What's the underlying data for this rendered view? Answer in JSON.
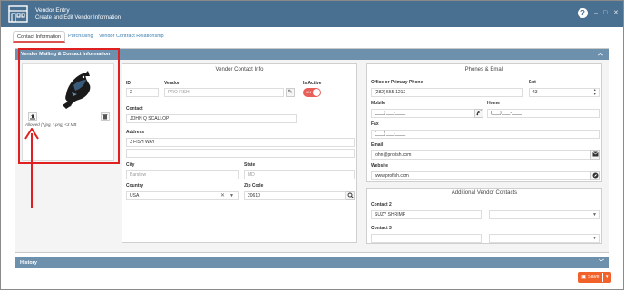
{
  "window": {
    "title": "Vendor Entry",
    "subtitle": "Create and Edit Vendor Information",
    "help": "?",
    "minimize": "–",
    "maximize": "□",
    "close": "✕"
  },
  "tabs": [
    {
      "label": "Contact Information",
      "active": true
    },
    {
      "label": "Purchasing",
      "active": false
    },
    {
      "label": "Vendor Contract Relationship",
      "active": false
    }
  ],
  "panel": {
    "title": "Vendor Mailing & Contact Information",
    "allowed": "Allowed (*.jpg, *.png) <3 MB"
  },
  "contact_info": {
    "title": "Vendor Contact Info",
    "id_label": "ID",
    "id_value": "2",
    "vendor_label": "Vendor",
    "vendor_value": "PRO FISH",
    "active_label": "Is Active",
    "active_toggle": "ON",
    "is_active": true,
    "contact_label": "Contact",
    "contact_value": "JOHN Q SCALLOP",
    "address_label": "Address",
    "address_value": "3 FISH WAY",
    "city_label": "City",
    "city_placeholder": "Barstow",
    "state_label": "State",
    "state_placeholder": "MD",
    "country_label": "Country",
    "country_value": "USA",
    "zip_label": "Zip Code",
    "zip_value": "20610"
  },
  "phone_email": {
    "title": "Phones & Email",
    "office_label": "Office or Primary Phone",
    "office_value": "(282) 555-1212",
    "ext_label": "Ext",
    "ext_value": "43",
    "mobile_label": "Mobile",
    "mobile_placeholder": "(___) ___-____",
    "home_label": "Home",
    "home_placeholder": "(___) ___-____",
    "fax_label": "Fax",
    "fax_placeholder": "(___) ___-____",
    "email_label": "Email",
    "email_value": "john@profish.com",
    "website_label": "Website",
    "website_value": "www.profish.com"
  },
  "additional": {
    "title": "Additional Vendor Contacts",
    "contact2_label": "Contact 2",
    "contact2_value": "SUZY SHRIMP",
    "contact3_label": "Contact 3"
  },
  "history": {
    "title": "History"
  },
  "footer": {
    "save_label": "Save"
  },
  "colors": {
    "titlebar": "#4a7091",
    "panel_header": "#6d90ad",
    "accent": "#f0622a",
    "annotation": "#e02020"
  }
}
